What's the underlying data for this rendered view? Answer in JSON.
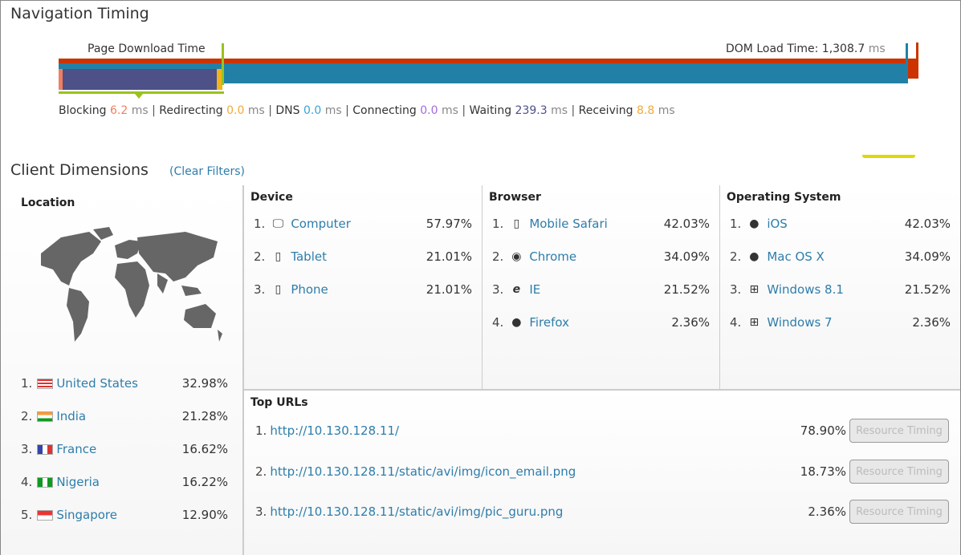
{
  "nav_timing": {
    "title": "Navigation Timing",
    "page_download_label": "Page Download Time",
    "dom_load_label": "DOM Load Time: 1,308.7",
    "dom_load_unit": "ms",
    "phases": [
      {
        "label": "Blocking",
        "value": "6.2",
        "unit": "ms",
        "color": "#f07f5f"
      },
      {
        "label": "Redirecting",
        "value": "0.0",
        "unit": "ms",
        "color": "#f2a93b"
      },
      {
        "label": "DNS",
        "value": "0.0",
        "unit": "ms",
        "color": "#3aa3d6"
      },
      {
        "label": "Connecting",
        "value": "0.0",
        "unit": "ms",
        "color": "#a56be0"
      },
      {
        "label": "Waiting",
        "value": "239.3",
        "unit": "ms",
        "color": "#333333"
      },
      {
        "label": "Receiving",
        "value": "8.8",
        "unit": "ms",
        "color": "#f2a93b"
      }
    ]
  },
  "client": {
    "title": "Client Dimensions",
    "clear_filters": "(Clear Filters)",
    "location": {
      "title": "Location",
      "items": [
        {
          "n": "1.",
          "label": "United States",
          "pct": "32.98%"
        },
        {
          "n": "2.",
          "label": "India",
          "pct": "21.28%"
        },
        {
          "n": "3.",
          "label": "France",
          "pct": "16.62%"
        },
        {
          "n": "4.",
          "label": "Nigeria",
          "pct": "16.22%"
        },
        {
          "n": "5.",
          "label": "Singapore",
          "pct": "12.90%"
        }
      ]
    },
    "device": {
      "title": "Device",
      "items": [
        {
          "n": "1.",
          "label": "Computer",
          "pct": "57.97%"
        },
        {
          "n": "2.",
          "label": "Tablet",
          "pct": "21.01%"
        },
        {
          "n": "3.",
          "label": "Phone",
          "pct": "21.01%"
        }
      ]
    },
    "browser": {
      "title": "Browser",
      "items": [
        {
          "n": "1.",
          "label": "Mobile Safari",
          "pct": "42.03%"
        },
        {
          "n": "2.",
          "label": "Chrome",
          "pct": "34.09%"
        },
        {
          "n": "3.",
          "label": "IE",
          "pct": "21.52%"
        },
        {
          "n": "4.",
          "label": "Firefox",
          "pct": "2.36%"
        }
      ]
    },
    "os": {
      "title": "Operating System",
      "items": [
        {
          "n": "1.",
          "label": "iOS",
          "pct": "42.03%"
        },
        {
          "n": "2.",
          "label": "Mac OS X",
          "pct": "34.09%"
        },
        {
          "n": "3.",
          "label": "Windows 8.1",
          "pct": "21.52%"
        },
        {
          "n": "4.",
          "label": "Windows 7",
          "pct": "2.36%"
        }
      ]
    },
    "urls": {
      "title": "Top URLs",
      "button": "Resource Timing",
      "items": [
        {
          "n": "1.",
          "label": "http://10.130.128.11/",
          "pct": "78.90%"
        },
        {
          "n": "2.",
          "label": "http://10.130.128.11/static/avi/img/icon_email.png",
          "pct": "18.73%"
        },
        {
          "n": "3.",
          "label": "http://10.130.128.11/static/avi/img/pic_guru.png",
          "pct": "2.36%"
        }
      ]
    }
  }
}
